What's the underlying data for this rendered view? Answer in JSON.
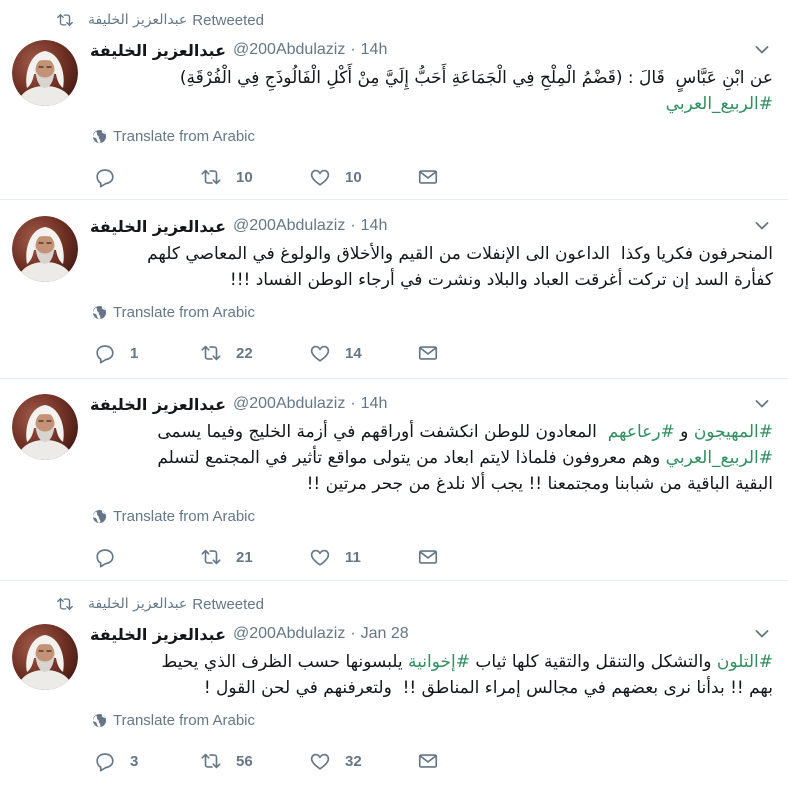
{
  "colors": {
    "text": "#14171a",
    "secondary": "#657786",
    "hashtag": "#2f8f5f",
    "divider": "#e6ecf0",
    "background": "#ffffff"
  },
  "timeline": {
    "tweets": [
      {
        "retweeted_by": {
          "icon": "retweet-icon",
          "name": "عبدالعزيز الخليفة",
          "label": "Retweeted"
        },
        "author": {
          "name": "عبدالعزيز الخليفة",
          "handle": "@200Abdulaziz",
          "separator": "·",
          "time": "14h"
        },
        "menu_icon": "chevron-down-icon",
        "lines": [
          [
            {
              "text": "عن ابْنِ عَبَّاسٍ  قَالَ : (قَضْمُ الْمِلْحِ فِي الْجَمَاعَةِ أَحَبُّ إِلَيَّ مِنْ أَكْلِ الْفَالُوذَجِ فِي الْفُرْقَةِ)"
            }
          ],
          [
            {
              "text": "#الربيع_العربي",
              "hashtag": true
            }
          ]
        ],
        "translate": {
          "icon": "globe-icon",
          "label": "Translate from Arabic"
        },
        "actions": {
          "reply": {
            "icon": "reply-icon"
          },
          "retweet": {
            "icon": "retweet-icon",
            "count": "10"
          },
          "like": {
            "icon": "heart-icon",
            "count": "10"
          },
          "message": {
            "icon": "envelope-icon"
          }
        }
      },
      {
        "author": {
          "name": "عبدالعزيز الخليفة",
          "handle": "@200Abdulaziz",
          "separator": "·",
          "time": "14h"
        },
        "menu_icon": "chevron-down-icon",
        "lines": [
          [
            {
              "text": "المنحرفون فكريا وكذا  الداعون الى الإنفلات من القيم والأخلاق والولوغ في المعاصي كلهم"
            }
          ],
          [
            {
              "text": "كفأرة السد إن تركت أغرقت العباد والبلاد ونشرت في أرجاء الوطن الفساد !!!"
            }
          ]
        ],
        "translate": {
          "icon": "globe-icon",
          "label": "Translate from Arabic"
        },
        "actions": {
          "reply": {
            "icon": "reply-icon",
            "count": "1"
          },
          "retweet": {
            "icon": "retweet-icon",
            "count": "22"
          },
          "like": {
            "icon": "heart-icon",
            "count": "14"
          },
          "message": {
            "icon": "envelope-icon"
          }
        }
      },
      {
        "author": {
          "name": "عبدالعزيز الخليفة",
          "handle": "@200Abdulaziz",
          "separator": "·",
          "time": "14h"
        },
        "menu_icon": "chevron-down-icon",
        "lines": [
          [
            {
              "text": "#المهيجون",
              "hashtag": true
            },
            {
              "text": " و "
            },
            {
              "text": "#رعاعهم",
              "hashtag": true
            },
            {
              "text": "  المعادون للوطن انكشفت أوراقهم في أزمة الخليج وفيما يسمى"
            }
          ],
          [
            {
              "text": "#الربيع_العربي",
              "hashtag": true
            },
            {
              "text": " وهم معروفون فلماذا لايتم ابعاد من يتولى مواقع تأثير في المجتمع لتسلم"
            }
          ],
          [
            {
              "text": "البقية الباقية من شبابنا ومجتمعنا !! يجب ألا نلدغ من جحر مرتين !!"
            }
          ]
        ],
        "translate": {
          "icon": "globe-icon",
          "label": "Translate from Arabic"
        },
        "actions": {
          "reply": {
            "icon": "reply-icon"
          },
          "retweet": {
            "icon": "retweet-icon",
            "count": "21"
          },
          "like": {
            "icon": "heart-icon",
            "count": "11"
          },
          "message": {
            "icon": "envelope-icon"
          }
        }
      },
      {
        "retweeted_by": {
          "icon": "retweet-icon",
          "name": "عبدالعزيز الخليفة",
          "label": "Retweeted"
        },
        "author": {
          "name": "عبدالعزيز الخليفة",
          "handle": "@200Abdulaziz",
          "separator": "·",
          "time": "Jan 28"
        },
        "menu_icon": "chevron-down-icon",
        "lines": [
          [
            {
              "text": "#التلون",
              "hashtag": true
            },
            {
              "text": " والتشكل والتنقل والتقية كلها ثياب "
            },
            {
              "text": "#إخوانية",
              "hashtag": true
            },
            {
              "text": " يلبسونها حسب الظرف الذي يحيط"
            }
          ],
          [
            {
              "text": "بهم !! بدأنا نرى بعضهم في مجالس إمراء المناطق !!  ولتعرفنهم في لحن القول !"
            }
          ]
        ],
        "translate": {
          "icon": "globe-icon",
          "label": "Translate from Arabic"
        },
        "actions": {
          "reply": {
            "icon": "reply-icon",
            "count": "3"
          },
          "retweet": {
            "icon": "retweet-icon",
            "count": "56"
          },
          "like": {
            "icon": "heart-icon",
            "count": "32"
          },
          "message": {
            "icon": "envelope-icon"
          }
        }
      }
    ]
  }
}
